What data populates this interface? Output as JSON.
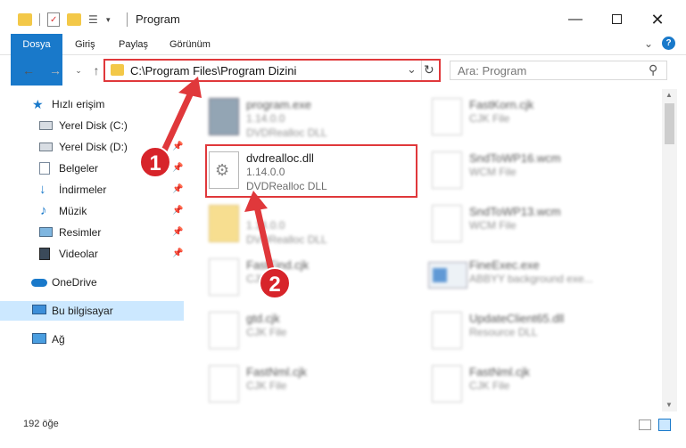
{
  "window": {
    "title": "Program"
  },
  "ribbon": {
    "tabs": [
      "Dosya",
      "Giriş",
      "Paylaş",
      "Görünüm"
    ]
  },
  "address": {
    "path": "C:\\Program Files\\Program Dizini"
  },
  "search": {
    "placeholder": "Ara: Program"
  },
  "sidebar": {
    "quick_access": "Hızlı erişim",
    "items": [
      {
        "label": "Yerel Disk (C:)",
        "icon": "drive-icon"
      },
      {
        "label": "Yerel Disk (D:)",
        "icon": "drive-icon"
      },
      {
        "label": "Belgeler",
        "icon": "documents-icon"
      },
      {
        "label": "İndirmeler",
        "icon": "download-icon"
      },
      {
        "label": "Müzik",
        "icon": "music-icon"
      },
      {
        "label": "Resimler",
        "icon": "pictures-icon"
      },
      {
        "label": "Videolar",
        "icon": "videos-icon"
      }
    ],
    "onedrive": "OneDrive",
    "this_pc": "Bu bilgisayar",
    "network": "Ağ"
  },
  "files": {
    "left": [
      {
        "name": "program.exe",
        "line1": "1.14.0.0",
        "line2": "DVDRealloc DLL"
      },
      {
        "name": "dvdrealloc.dll",
        "line1": "1.14.0.0",
        "line2": "DVDRealloc DLL"
      },
      {
        "name": "",
        "line1": "1.14.0.0",
        "line2": "DVDRealloc DLL"
      },
      {
        "name": "FastFind.cjk",
        "line1": "CJK File",
        "line2": ""
      },
      {
        "name": "gtd.cjk",
        "line1": "CJK File",
        "line2": ""
      },
      {
        "name": "FastNml.cjk",
        "line1": "CJK File",
        "line2": ""
      }
    ],
    "right": [
      {
        "name": "FastKorn.cjk",
        "line1": "CJK File",
        "line2": ""
      },
      {
        "name": "SndToWP16.wcm",
        "line1": "WCM File",
        "line2": ""
      },
      {
        "name": "SndToWP13.wcm",
        "line1": "WCM File",
        "line2": ""
      },
      {
        "name": "FineExec.exe",
        "line1": "ABBYY background exe...",
        "line2": ""
      },
      {
        "name": "UpdateClient65.dll",
        "line1": "Resource DLL",
        "line2": ""
      },
      {
        "name": "FastNml.cjk",
        "line1": "CJK File",
        "line2": ""
      }
    ]
  },
  "status": {
    "count": "192 öğe"
  },
  "annotations": {
    "step1": "1",
    "step2": "2",
    "color": "#e0383b"
  }
}
